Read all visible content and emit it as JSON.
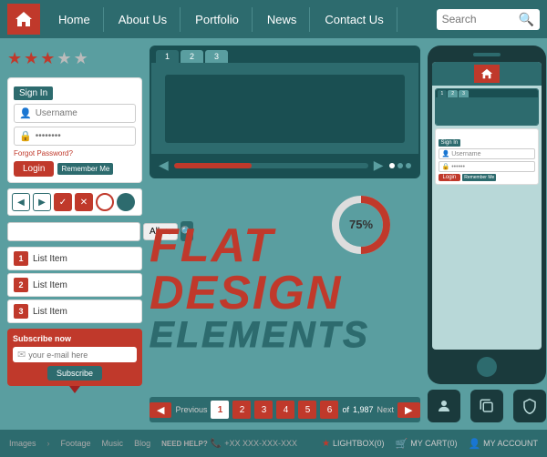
{
  "navbar": {
    "logo_alt": "home",
    "items": [
      {
        "label": "Home",
        "id": "home"
      },
      {
        "label": "About Us",
        "id": "about"
      },
      {
        "label": "Portfolio",
        "id": "portfolio"
      },
      {
        "label": "News",
        "id": "news"
      },
      {
        "label": "Contact Us",
        "id": "contact"
      }
    ],
    "search_placeholder": "Search"
  },
  "stars": {
    "filled": 3,
    "total": 5
  },
  "login": {
    "title": "Sign In",
    "username_placeholder": "Username",
    "password_placeholder": "••••••••",
    "forgot_label": "Forgot Password?",
    "login_btn": "Login",
    "remember_label": "Remember Me"
  },
  "list_items": [
    {
      "num": "1",
      "label": "List Item"
    },
    {
      "num": "2",
      "label": "List Item"
    },
    {
      "num": "3",
      "label": "List Item"
    }
  ],
  "subscribe": {
    "label": "Subscribe now",
    "placeholder": "your e-mail here",
    "btn_label": "Subscribe"
  },
  "search_bar": {
    "dropdown_default": "All"
  },
  "browser": {
    "tabs": [
      "1",
      "2",
      "3"
    ]
  },
  "big_text": {
    "line1": "FLAT",
    "line2": "DESIGN",
    "line3": "ELEMENTS"
  },
  "donut": {
    "percent": 75,
    "label": "75%"
  },
  "pagination": {
    "prev_label": "Previous",
    "next_label": "Next",
    "pages": [
      "1",
      "2",
      "3",
      "4",
      "5",
      "6"
    ],
    "active_page": "1",
    "total": "1,987"
  },
  "phone": {
    "login": {
      "title": "Sign In",
      "username_placeholder": "Username",
      "password_placeholder": "••••••",
      "login_btn": "Login",
      "remember_label": "Remember Me"
    }
  },
  "icons": {
    "user_icon": "👤",
    "copy_icon": "⧉",
    "lock_icon": "🔒"
  },
  "bottom_bar": {
    "links": [
      "Images",
      "Footage",
      "Music",
      "Blog"
    ],
    "need_help": "NEED HELP?",
    "phone": "+XX XXX-XXX-XXX",
    "lightbox": "LIGHTBOX(0)",
    "cart": "MY CART(0)",
    "account": "MY ACCOUNT"
  }
}
